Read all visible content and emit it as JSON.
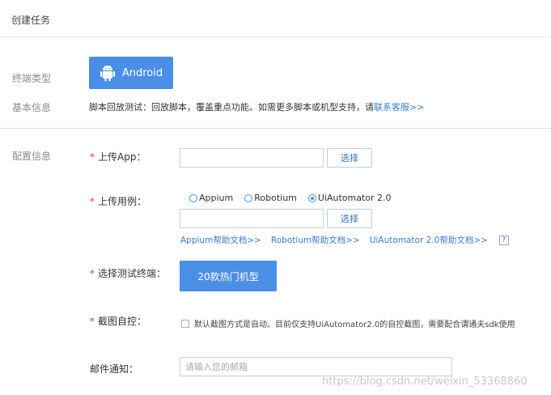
{
  "header": {
    "title": "创建任务"
  },
  "sections": {
    "terminal_type": "终端类型",
    "basic_info": "基本信息",
    "config_info": "配置信息"
  },
  "terminal": {
    "android_label": "Android"
  },
  "basic": {
    "description": "脚本回放测试：回放脚本，覆盖重点功能。如需更多脚本或机型支持，请",
    "contact_link": "联系客服>>"
  },
  "upload_app": {
    "required_mark": "*",
    "label": "上传App：",
    "value": "",
    "select_label": "选择"
  },
  "upload_case": {
    "required_mark": "*",
    "label": "上传用例：",
    "options": [
      {
        "label": "Appium",
        "checked": false
      },
      {
        "label": "Robotium",
        "checked": false
      },
      {
        "label": "UiAutomator 2.0",
        "checked": true
      }
    ],
    "value": "",
    "select_label": "选择",
    "doc_links": [
      "Appium帮助文档>>",
      "Robotium帮助文档>>",
      "UiAutomator 2.0帮助文档>>"
    ],
    "help_icon": "?"
  },
  "device": {
    "required_mark": "*",
    "label": "选择测试终端：",
    "button_label": "20款热门机型"
  },
  "screenshot": {
    "required_mark": "*",
    "label": "截图自控：",
    "checkbox_text": "默认截图方式是自动。目前仅支持UiAutomator2.0的自控截图，需要配合谓通夫sdk使用",
    "checked": false
  },
  "email": {
    "label": "邮件通知：",
    "placeholder": "请输入您的邮箱",
    "value": ""
  },
  "watermark": "https://blog.csdn.net/weixin_53368860",
  "colors": {
    "primary": "#4a8fe7",
    "link": "#3a7bd5",
    "required": "#e4393c"
  }
}
